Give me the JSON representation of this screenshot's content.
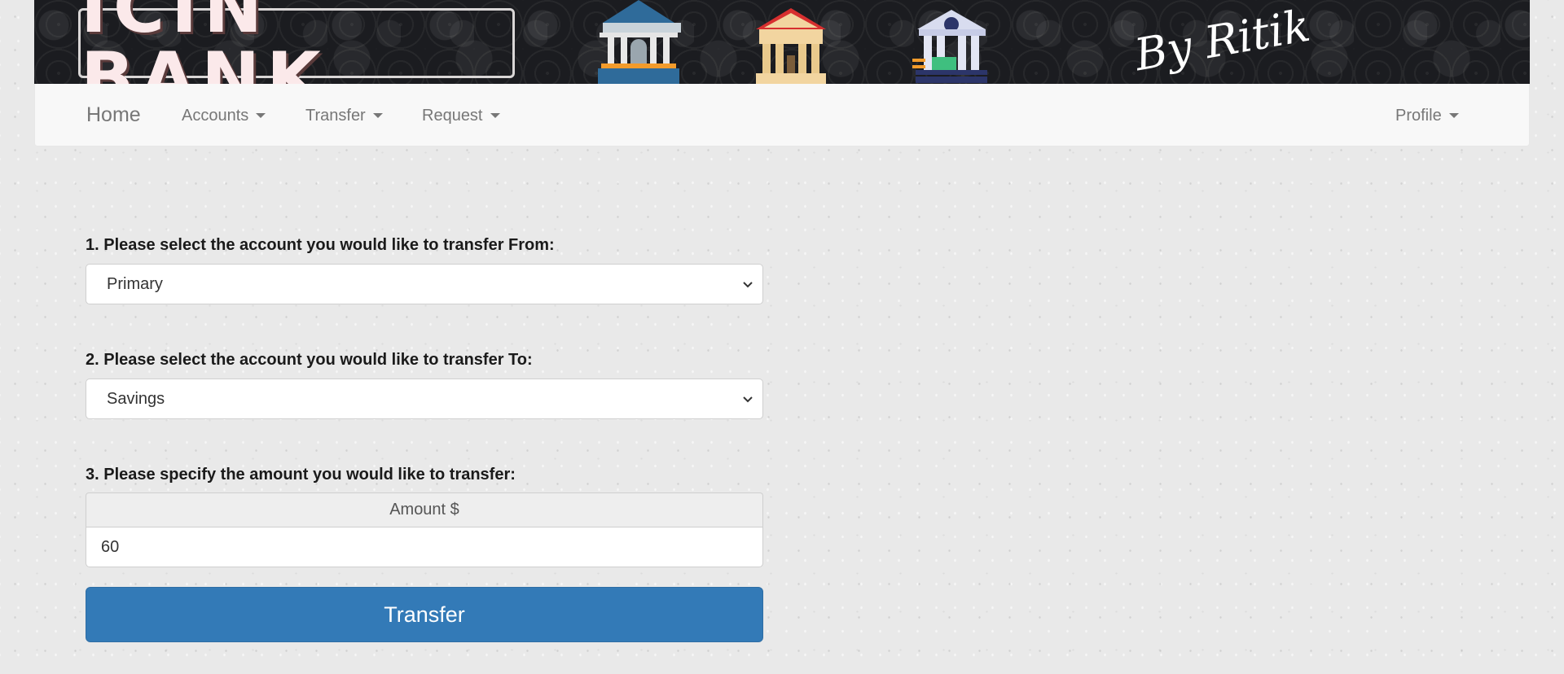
{
  "banner": {
    "logo_text": "ICIN BANK",
    "signature": "By Ritik",
    "icons": [
      "bank-building-icon",
      "bank-house-icon",
      "bank-money-icon"
    ]
  },
  "navbar": {
    "brand": "Home",
    "items": [
      {
        "label": "Accounts"
      },
      {
        "label": "Transfer"
      },
      {
        "label": "Request"
      }
    ],
    "profile": "Profile"
  },
  "form": {
    "from_label": "1. Please select the account you would like to transfer From:",
    "from_value": "Primary",
    "to_label": "2. Please select the account you would like to transfer To:",
    "to_value": "Savings",
    "amount_label": "3. Please specify the amount you would like to transfer:",
    "amount_addon": "Amount $",
    "amount_value": "60",
    "submit_label": "Transfer"
  },
  "colors": {
    "primary_button": "#337ab7",
    "navbar_bg": "#f8f8f8",
    "banner_bg": "#1b1c20"
  }
}
